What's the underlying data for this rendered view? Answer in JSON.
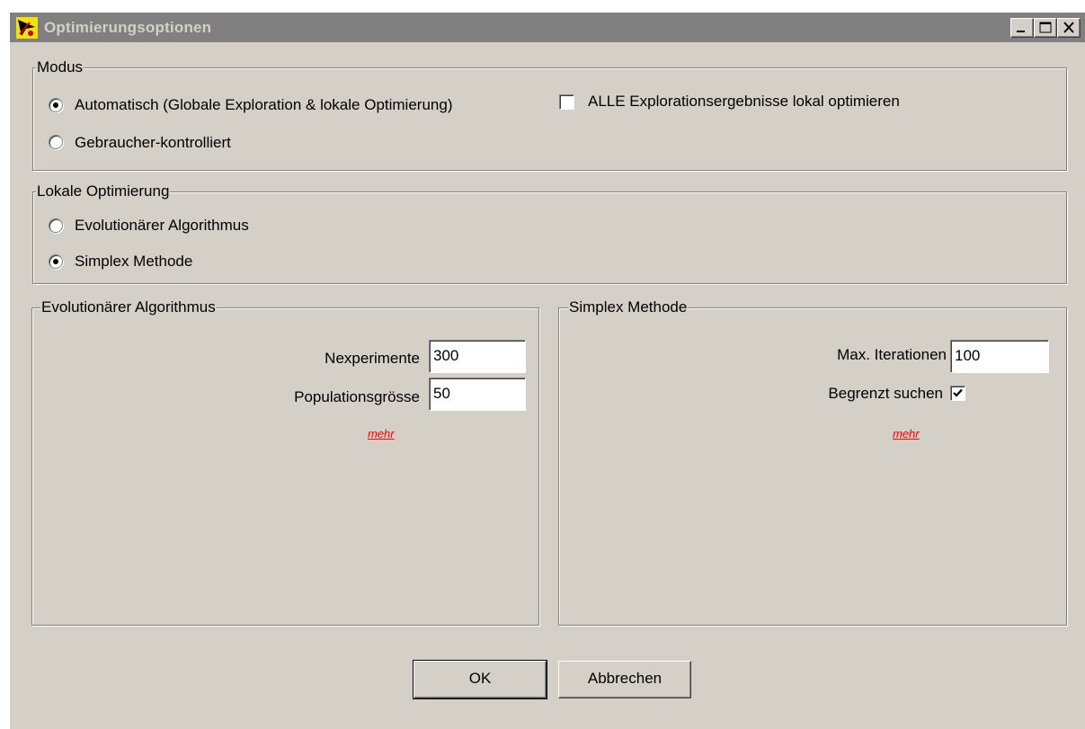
{
  "window": {
    "title": "Optimierungsoptionen",
    "icon": "optimizer-app-icon",
    "controls": {
      "minimize": "minimize-icon",
      "maximize": "maximize-icon",
      "close": "close-icon"
    }
  },
  "modus": {
    "legend": "Modus",
    "options": [
      {
        "label": "Automatisch (Globale Exploration & lokale Optimierung)",
        "selected": true
      },
      {
        "label": "Gebraucher-kontrolliert",
        "selected": false
      }
    ],
    "optimize_all": {
      "label": "ALLE Explorationsergebnisse lokal optimieren",
      "checked": false
    }
  },
  "local_optimization": {
    "legend": "Lokale Optimierung",
    "options": [
      {
        "label": "Evolutionärer Algorithmus",
        "selected": false
      },
      {
        "label": "Simplex Methode",
        "selected": true
      }
    ]
  },
  "evolutionary": {
    "legend": "Evolutionärer Algorithmus",
    "nexperiments_label": "Nexperimente",
    "nexperiments_value": "300",
    "population_label": "Populationsgrösse",
    "population_value": "50",
    "more_link": "mehr"
  },
  "simplex": {
    "legend": "Simplex Methode",
    "max_iterations_label": "Max. Iterationen",
    "max_iterations_value": "100",
    "bounded_label": "Begrenzt suchen",
    "bounded_checked": true,
    "more_link": "mehr"
  },
  "buttons": {
    "ok": "OK",
    "cancel": "Abbrechen"
  },
  "colors": {
    "face": "#d4d0c8",
    "titlebar_inactive": "#808080",
    "link": "#ff0000"
  }
}
